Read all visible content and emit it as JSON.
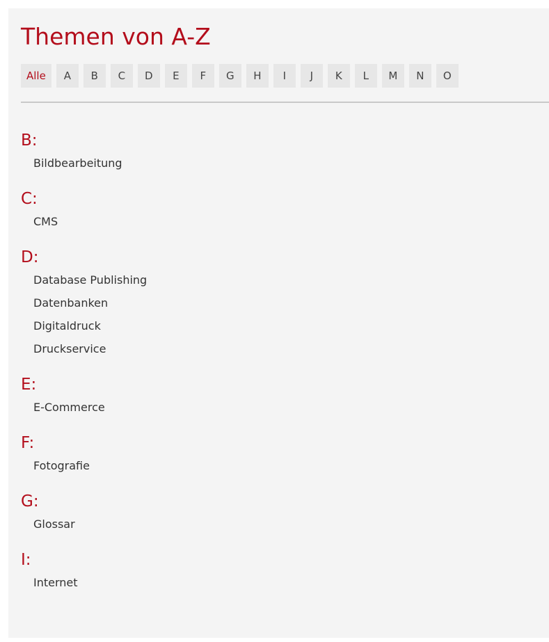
{
  "title": "Themen von A-Z",
  "alphabet": [
    "Alle",
    "A",
    "B",
    "C",
    "D",
    "E",
    "F",
    "G",
    "H",
    "I",
    "J",
    "K",
    "L",
    "M",
    "N",
    "O"
  ],
  "active_letter": "Alle",
  "colors": {
    "accent": "#b30d1b",
    "page_background": "#f4f4f4",
    "nav_item_background": "#e7e7e7",
    "text": "#333333",
    "divider": "#c9c9c9"
  },
  "sections": [
    {
      "heading": "B:",
      "items": [
        "Bildbearbeitung"
      ]
    },
    {
      "heading": "C:",
      "items": [
        "CMS"
      ]
    },
    {
      "heading": "D:",
      "items": [
        "Database Publishing",
        "Datenbanken",
        "Digitaldruck",
        "Druckservice"
      ]
    },
    {
      "heading": "E:",
      "items": [
        "E-Commerce"
      ]
    },
    {
      "heading": "F:",
      "items": [
        "Fotografie"
      ]
    },
    {
      "heading": "G:",
      "items": [
        "Glossar"
      ]
    },
    {
      "heading": "I:",
      "items": [
        "Internet"
      ]
    }
  ]
}
